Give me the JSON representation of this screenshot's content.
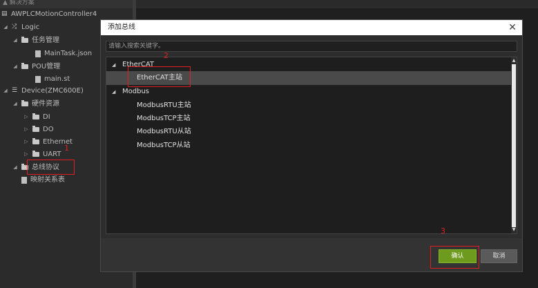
{
  "left_panel": {
    "header": "▲ 解决方案",
    "tree": [
      {
        "label": "AWPLCMotionController4",
        "icon": "solution-icon"
      },
      {
        "label": "Logic",
        "icon": "logic-icon",
        "arrow": "◢"
      },
      {
        "label": "任务管理",
        "icon": "folder-icon",
        "arrow": "◢"
      },
      {
        "label": "MainTask.json",
        "icon": "file-icon"
      },
      {
        "label": "POU管理",
        "icon": "folder-icon",
        "arrow": "◢"
      },
      {
        "label": "main.st",
        "icon": "file-icon"
      },
      {
        "label": "Device(ZMC600E)",
        "icon": "device-icon",
        "arrow": "◢"
      },
      {
        "label": "硬件资源",
        "icon": "folder-icon",
        "arrow": "◢"
      },
      {
        "label": "DI",
        "icon": "folder-icon",
        "arrow": "▷"
      },
      {
        "label": "DO",
        "icon": "folder-icon",
        "arrow": "▷"
      },
      {
        "label": "Ethernet",
        "icon": "folder-icon",
        "arrow": "▷"
      },
      {
        "label": "UART",
        "icon": "folder-icon",
        "arrow": "▷"
      },
      {
        "label": "总线协议",
        "icon": "folder-icon",
        "arrow": "◢"
      },
      {
        "label": "映射关系表",
        "icon": "file-icon"
      }
    ]
  },
  "dialog": {
    "title": "添加总线",
    "close": "✕",
    "search_placeholder": "请输入搜索关键字。",
    "list": [
      {
        "label": "EtherCAT",
        "group": true,
        "arrow": "◢"
      },
      {
        "label": "EtherCAT主站",
        "selected": true
      },
      {
        "label": "Modbus",
        "group": true,
        "arrow": "◢"
      },
      {
        "label": "ModbusRTU主站"
      },
      {
        "label": "ModbusTCP主站"
      },
      {
        "label": "ModbusRTU从站"
      },
      {
        "label": "ModbusTCP从站"
      }
    ],
    "confirm_label": "确认",
    "cancel_label": "取消"
  },
  "annotations": {
    "step1": "1",
    "step2": "2",
    "step3": "3"
  },
  "colors": {
    "accent_green": "#6e9a1e",
    "annotation_red": "#e02020"
  }
}
